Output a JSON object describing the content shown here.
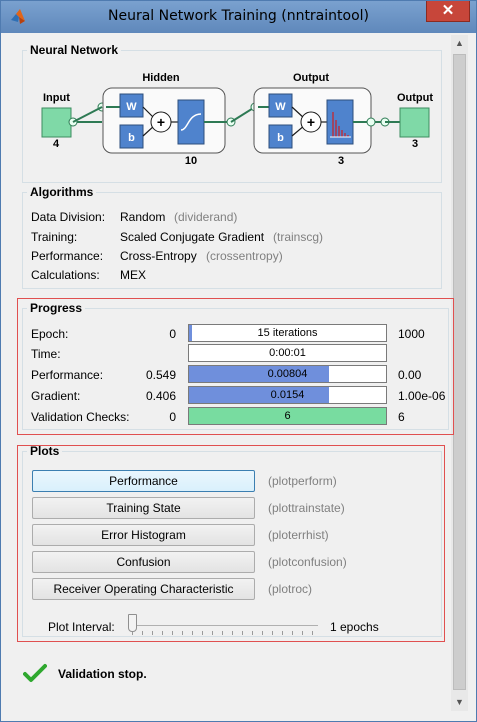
{
  "window": {
    "title": "Neural Network Training (nntraintool)",
    "close_glyph": "✕"
  },
  "network": {
    "section_title": "Neural Network",
    "input_label": "Input",
    "input_size": "4",
    "hidden_label": "Hidden",
    "hidden_size": "10",
    "output_layer_label": "Output",
    "output_layer_size": "3",
    "output_label": "Output",
    "output_size": "3",
    "weight_symbol": "W",
    "bias_symbol": "b",
    "sum_symbol": "+"
  },
  "algorithms": {
    "section_title": "Algorithms",
    "rows": [
      {
        "label": "Data Division:",
        "value": "Random",
        "fn": "(dividerand)"
      },
      {
        "label": "Training:",
        "value": "Scaled Conjugate Gradient",
        "fn": "(trainscg)"
      },
      {
        "label": "Performance:",
        "value": "Cross-Entropy",
        "fn": "(crossentropy)"
      },
      {
        "label": "Calculations:",
        "value": "MEX",
        "fn": ""
      }
    ]
  },
  "progress": {
    "section_title": "Progress",
    "rows": [
      {
        "label": "Epoch:",
        "start": "0",
        "bar_text": "15 iterations",
        "end": "1000",
        "fill": 0.015,
        "fill_color": "#6f8fdc"
      },
      {
        "label": "Time:",
        "start": "",
        "bar_text": "0:00:01",
        "end": "",
        "fill": 0,
        "fill_color": "#6f8fdc"
      },
      {
        "label": "Performance:",
        "start": "0.549",
        "bar_text": "0.00804",
        "end": "0.00",
        "fill": 0.71,
        "fill_color": "#6f8fdc"
      },
      {
        "label": "Gradient:",
        "start": "0.406",
        "bar_text": "0.0154",
        "end": "1.00e-06",
        "fill": 0.71,
        "fill_color": "#6f8fdc"
      },
      {
        "label": "Validation Checks:",
        "start": "0",
        "bar_text": "6",
        "end": "6",
        "fill": 1.0,
        "fill_color": "#78dca0"
      }
    ]
  },
  "plots": {
    "section_title": "Plots",
    "buttons": [
      {
        "label": "Performance",
        "fn": "(plotperform)"
      },
      {
        "label": "Training State",
        "fn": "(plottrainstate)"
      },
      {
        "label": "Error Histogram",
        "fn": "(ploterrhist)"
      },
      {
        "label": "Confusion",
        "fn": "(plotconfusion)"
      },
      {
        "label": "Receiver Operating Characteristic",
        "fn": "(plotroc)"
      }
    ],
    "interval_label": "Plot Interval:",
    "interval_value": "1 epochs",
    "interval_fraction": 0
  },
  "status": {
    "text": "Validation stop."
  },
  "colors": {
    "node_fill": "#7fd9a7",
    "highlight_red": "#e05050",
    "progress_blue": "#6f8fdc",
    "progress_green": "#78dca0",
    "check_green": "#2fa82f"
  }
}
